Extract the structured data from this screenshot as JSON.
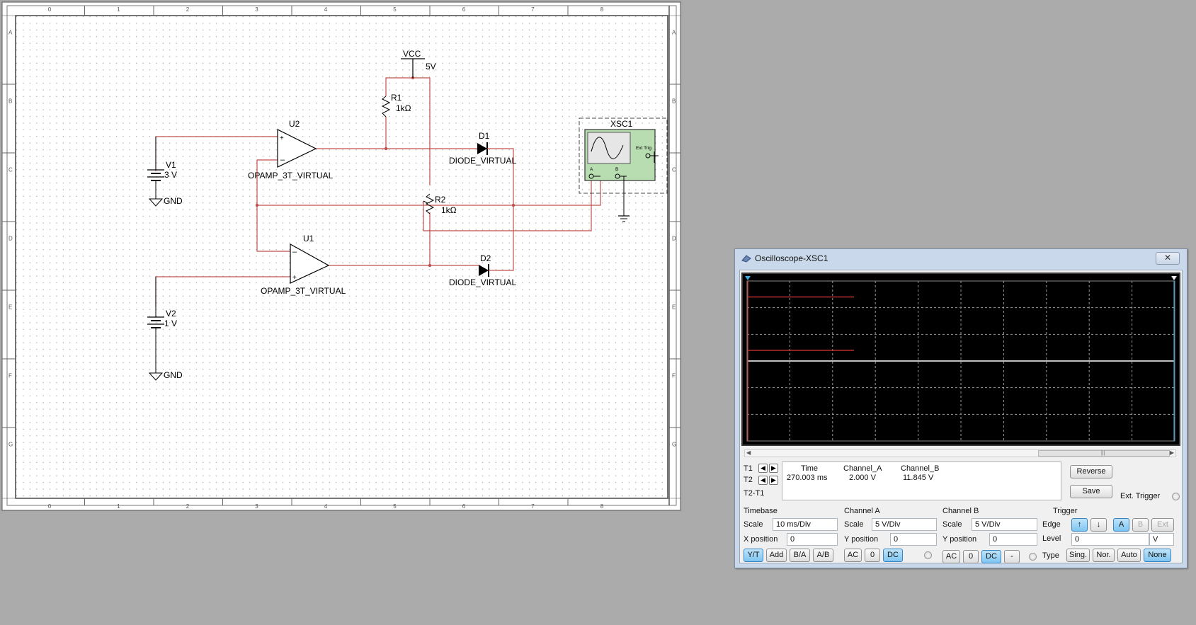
{
  "schematic": {
    "ruler_cols": [
      "0",
      "1",
      "2",
      "3",
      "4",
      "5",
      "6",
      "7",
      "8"
    ],
    "ruler_rows": [
      "A",
      "B",
      "C",
      "D",
      "E",
      "F",
      "G"
    ],
    "components": {
      "vcc_label": "VCC",
      "vcc_value": "5V",
      "r1_ref": "R1",
      "r1_value": "1kΩ",
      "r2_ref": "R2",
      "r2_value": "1kΩ",
      "u2_ref": "U2",
      "u2_type": "OPAMP_3T_VIRTUAL",
      "u1_ref": "U1",
      "u1_type": "OPAMP_3T_VIRTUAL",
      "d1_ref": "D1",
      "d1_type": "DIODE_VIRTUAL",
      "d2_ref": "D2",
      "d2_type": "DIODE_VIRTUAL",
      "v1_ref": "V1",
      "v1_value": "3 V",
      "v2_ref": "V2",
      "v2_value": "1 V",
      "gnd1": "GND",
      "gnd2": "GND",
      "xsc_ref": "XSC1",
      "xsc_ext": "Ext Trig",
      "xsc_a": "A",
      "xsc_b": "B"
    },
    "wire_color": "#c0504d"
  },
  "oscilloscope": {
    "title": "Oscilloscope-XSC1",
    "close": "✕",
    "trace_color": "#cc3333",
    "cursor_rows": {
      "t1": "T1",
      "t2": "T2",
      "t2t1": "T2-T1"
    },
    "readout": {
      "headers": [
        "Time",
        "Channel_A",
        "Channel_B"
      ],
      "t1": [
        "270.003 ms",
        "2.000 V",
        "11.845 V"
      ]
    },
    "reverse": "Reverse",
    "save": "Save",
    "ext_trigger": "Ext. Trigger",
    "timebase": {
      "title": "Timebase",
      "scale_label": "Scale",
      "scale": "10 ms/Div",
      "xpos_label": "X position",
      "xpos": "0",
      "buttons": [
        "Y/T",
        "Add",
        "B/A",
        "A/B"
      ]
    },
    "channel_a": {
      "title": "Channel A",
      "scale_label": "Scale",
      "scale": "5  V/Div",
      "ypos_label": "Y position",
      "ypos": "0",
      "buttons": [
        "AC",
        "0",
        "DC"
      ]
    },
    "channel_b": {
      "title": "Channel B",
      "scale_label": "Scale",
      "scale": "5  V/Div",
      "ypos_label": "Y position",
      "ypos": "0",
      "buttons": [
        "AC",
        "0",
        "DC",
        "-"
      ]
    },
    "trigger": {
      "title": "Trigger",
      "edge_label": "Edge",
      "edge_buttons": [
        "↑",
        "↓",
        "A",
        "B",
        "Ext"
      ],
      "level_label": "Level",
      "level": "0",
      "level_unit": "V",
      "type_label": "Type",
      "type_buttons": [
        "Sing.",
        "Nor.",
        "Auto",
        "None"
      ]
    }
  }
}
